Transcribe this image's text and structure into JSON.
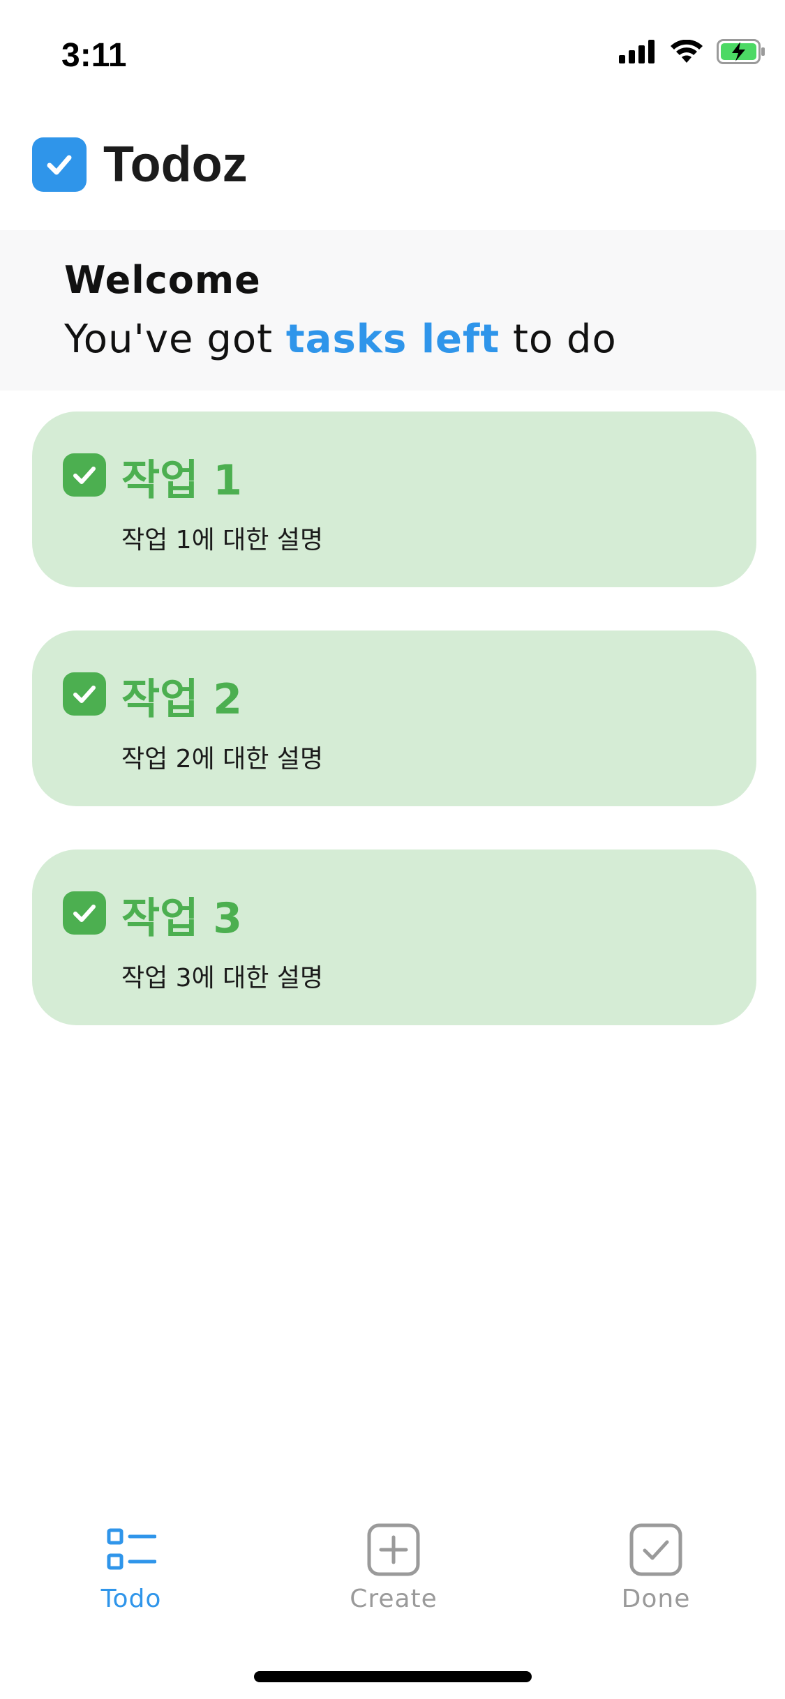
{
  "status_bar": {
    "time": "3:11",
    "icons": [
      "cellular-signal-icon",
      "wifi-icon",
      "battery-charging-icon"
    ]
  },
  "app": {
    "title": "Todoz",
    "logo_icon": "checkbox-icon",
    "accent_color": "#2f95ea"
  },
  "welcome": {
    "title": "Welcome",
    "subtitle_prefix": "You've got ",
    "subtitle_highlight": "tasks left",
    "subtitle_suffix": " to do"
  },
  "tasks": [
    {
      "title": "작업 1",
      "description": "작업 1에 대한 설명",
      "done": true
    },
    {
      "title": "작업 2",
      "description": "작업 2에 대한 설명",
      "done": true
    },
    {
      "title": "작업 3",
      "description": "작업 3에 대한 설명",
      "done": true
    }
  ],
  "task_colors": {
    "card_background": "#d5ecd5",
    "title_color": "#4caf50",
    "check_color": "#4caf50"
  },
  "tab_bar": {
    "active": "Todo",
    "tabs": [
      {
        "label": "Todo",
        "icon": "list-icon"
      },
      {
        "label": "Create",
        "icon": "plus-square-icon"
      },
      {
        "label": "Done",
        "icon": "check-square-icon"
      }
    ],
    "active_color": "#2f95ea",
    "inactive_color": "#9a9a9a"
  }
}
